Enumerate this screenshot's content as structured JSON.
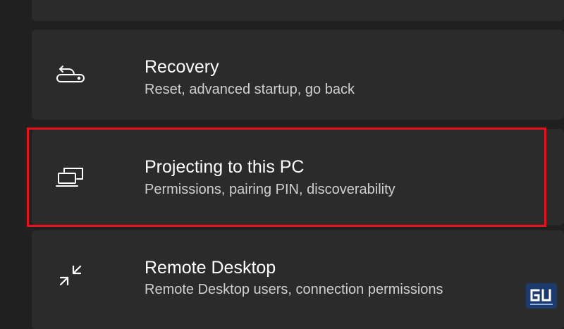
{
  "settings": {
    "items": [
      {
        "title": "Recovery",
        "subtitle": "Reset, advanced startup, go back",
        "icon": "recovery-icon"
      },
      {
        "title": "Projecting to this PC",
        "subtitle": "Permissions, pairing PIN, discoverability",
        "icon": "projecting-icon",
        "highlighted": true
      },
      {
        "title": "Remote Desktop",
        "subtitle": "Remote Desktop users, connection permissions",
        "icon": "remote-desktop-icon"
      }
    ]
  },
  "colors": {
    "background": "#202020",
    "card": "#2b2b2b",
    "highlight": "#e3141d",
    "text": "#ffffff",
    "subtext": "#d0d0d0"
  },
  "watermark": {
    "logo": "gadgets-to-use-logo"
  }
}
